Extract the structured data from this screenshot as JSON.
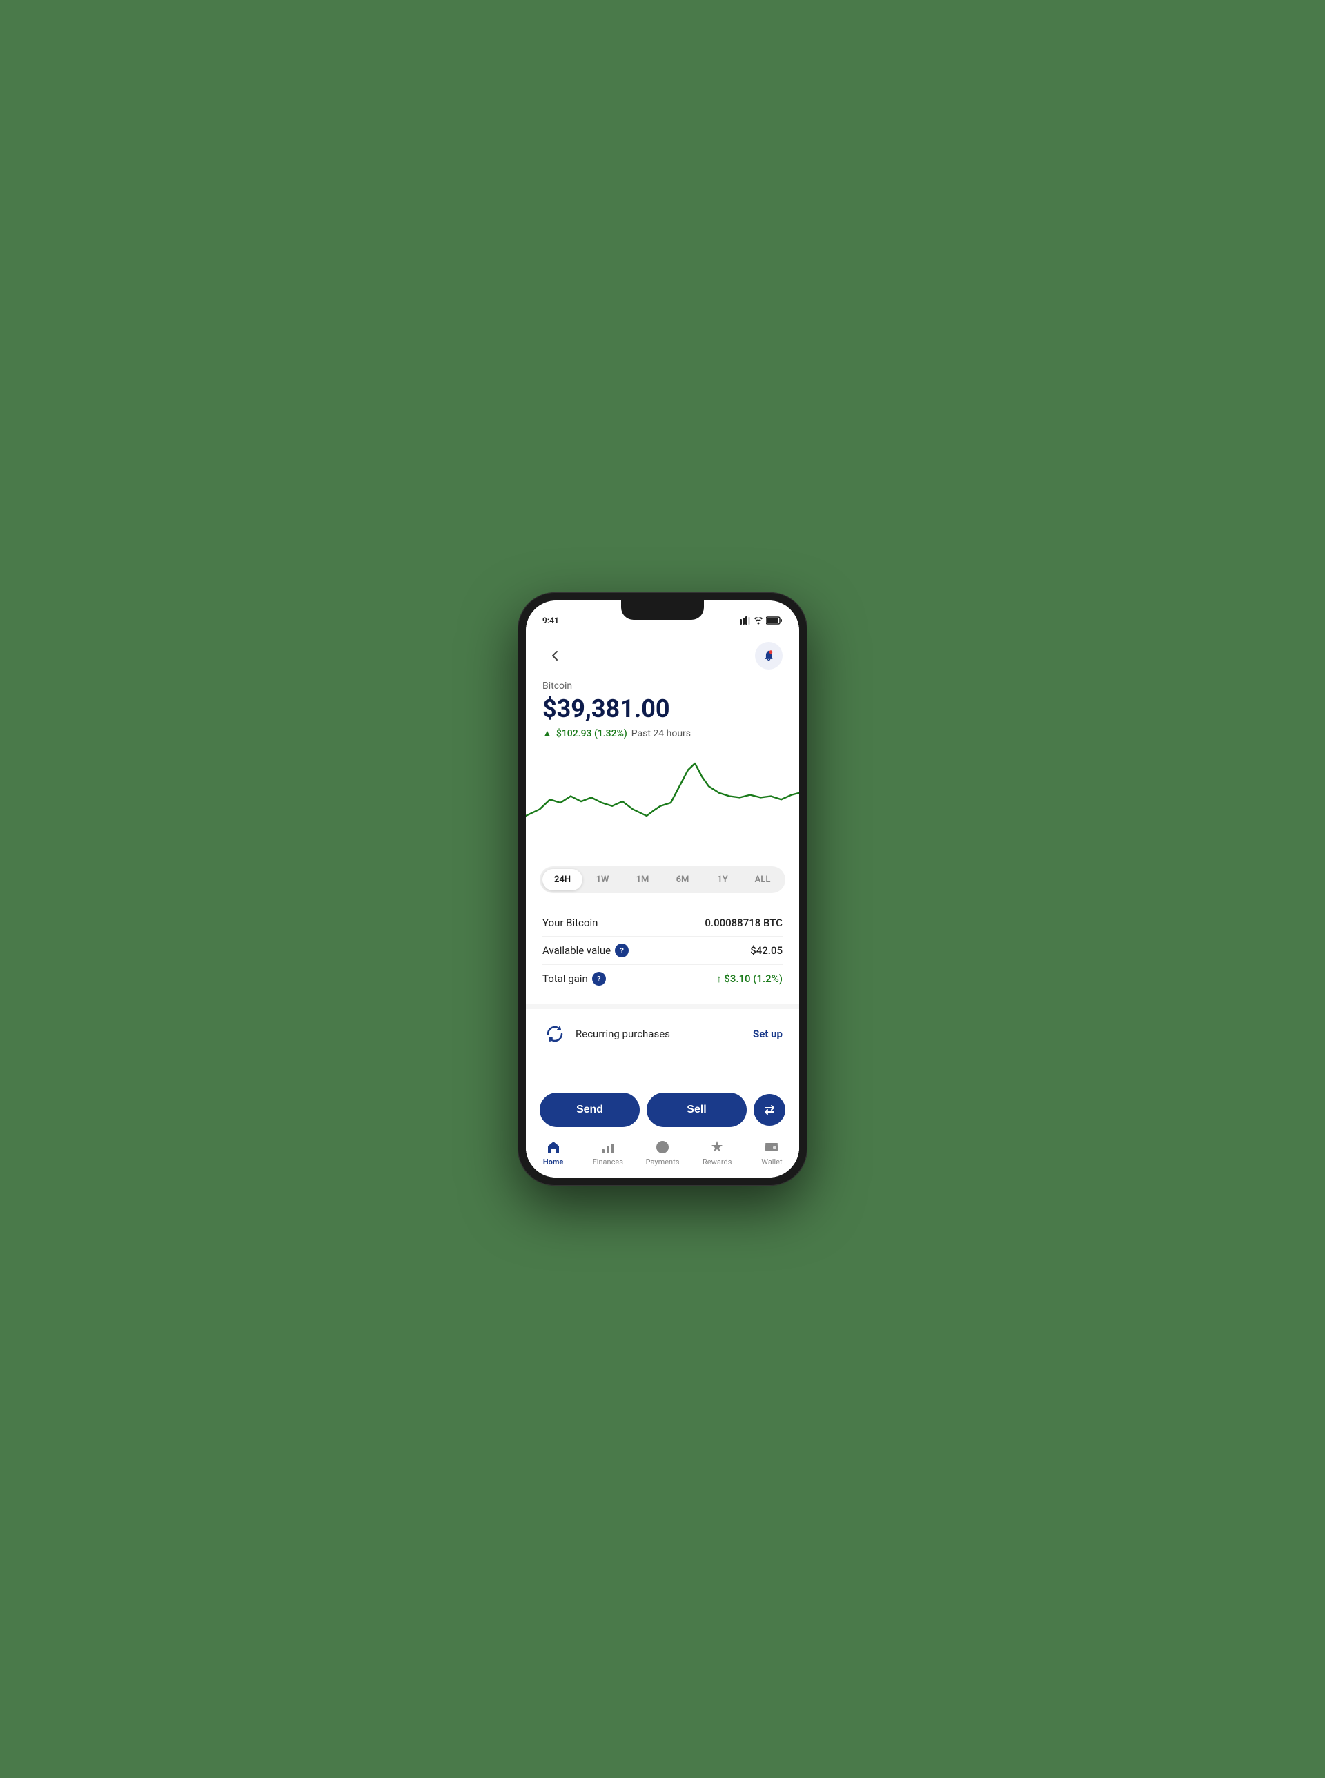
{
  "header": {
    "back_label": "←",
    "bell_label": "🔔"
  },
  "price_section": {
    "coin_name": "Bitcoin",
    "price": "$39,381.00",
    "change_amount": "$102.93 (1.32%)",
    "change_period": "Past 24 hours"
  },
  "time_filters": [
    {
      "label": "24H",
      "active": true
    },
    {
      "label": "1W",
      "active": false
    },
    {
      "label": "1M",
      "active": false
    },
    {
      "label": "6M",
      "active": false
    },
    {
      "label": "1Y",
      "active": false
    },
    {
      "label": "ALL",
      "active": false
    }
  ],
  "stats": {
    "your_bitcoin_label": "Your Bitcoin",
    "your_bitcoin_value": "0.00088718 BTC",
    "available_value_label": "Available value",
    "available_value_value": "$42.05",
    "total_gain_label": "Total gain",
    "total_gain_value": "↑ $3.10 (1.2%)"
  },
  "recurring": {
    "label": "Recurring purchases",
    "action": "Set up"
  },
  "actions": {
    "send": "Send",
    "sell": "Sell"
  },
  "nav": {
    "items": [
      {
        "label": "Home",
        "active": true
      },
      {
        "label": "Finances",
        "active": false
      },
      {
        "label": "Payments",
        "active": false
      },
      {
        "label": "Rewards",
        "active": false
      },
      {
        "label": "Wallet",
        "active": false
      }
    ]
  },
  "colors": {
    "primary": "#1a3a8a",
    "green": "#1a7a1a",
    "chart_line": "#1a7a1a"
  }
}
